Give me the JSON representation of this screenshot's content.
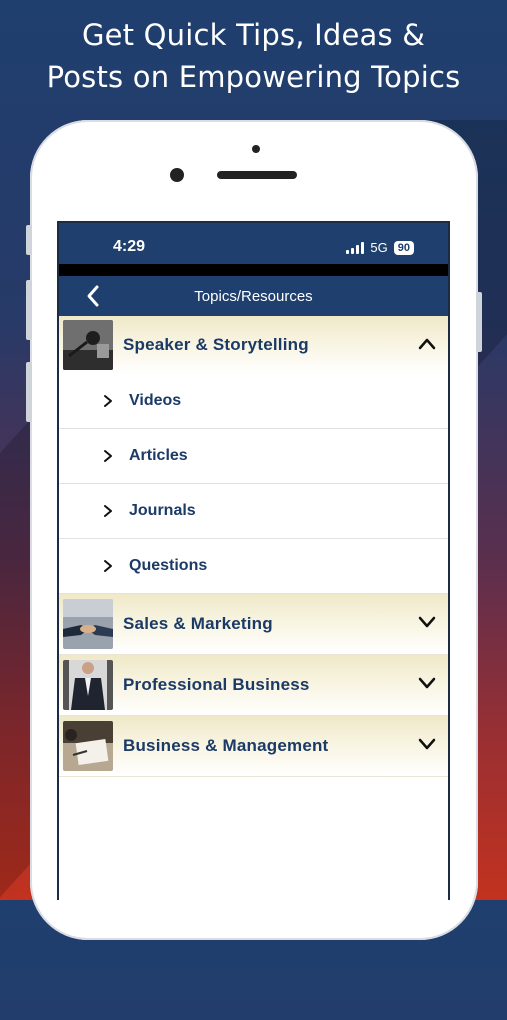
{
  "promo": {
    "line1": "Get Quick Tips, Ideas &",
    "line2": "Posts on Empowering Topics"
  },
  "status_bar": {
    "time": "4:29",
    "network": "5G",
    "battery": "90"
  },
  "nav": {
    "title": "Topics/Resources",
    "back_icon": "chevron-left-icon"
  },
  "categories": [
    {
      "label": "Speaker & Storytelling",
      "expanded": true,
      "subitems": [
        {
          "label": "Videos"
        },
        {
          "label": "Articles"
        },
        {
          "label": "Journals"
        },
        {
          "label": "Questions"
        }
      ]
    },
    {
      "label": "Sales & Marketing",
      "expanded": false
    },
    {
      "label": "Professional Business",
      "expanded": false
    },
    {
      "label": "Business & Management",
      "expanded": false
    }
  ],
  "colors": {
    "navy": "#1f3f6e",
    "label_blue": "#1c3a66",
    "category_tint": "#efe9c8"
  }
}
